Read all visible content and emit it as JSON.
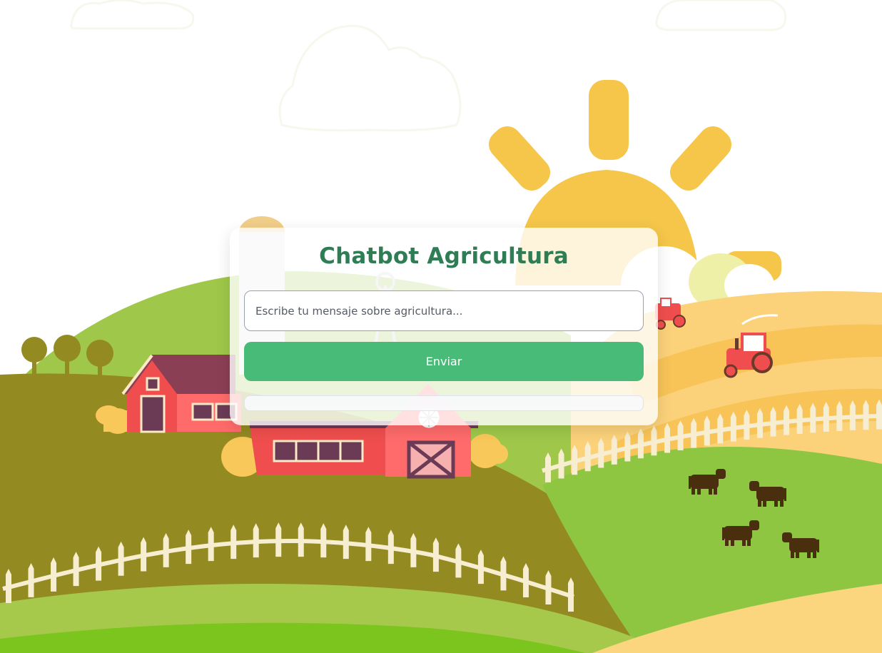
{
  "chat": {
    "title": "Chatbot Agricultura",
    "input_placeholder": "Escribe tu mensaje sobre agricultura...",
    "input_value": "",
    "send_label": "Enviar",
    "response_text": ""
  },
  "colors": {
    "title": "#2e7d55",
    "button": "#48bb78",
    "sun": "#f5c64a",
    "field_yellow": "#f9c85a",
    "hill_olive": "#938a22",
    "hill_green": "#8ec641",
    "barn_red": "#f04e4e",
    "fence": "#f7edd0"
  },
  "background": {
    "theme": "farm landscape illustration",
    "icons": [
      "sun-icon",
      "cloud-icon",
      "barn-icon",
      "tractor-icon",
      "cow-icon",
      "tree-icon",
      "fence-icon",
      "silo-icon",
      "windmill-icon"
    ]
  }
}
